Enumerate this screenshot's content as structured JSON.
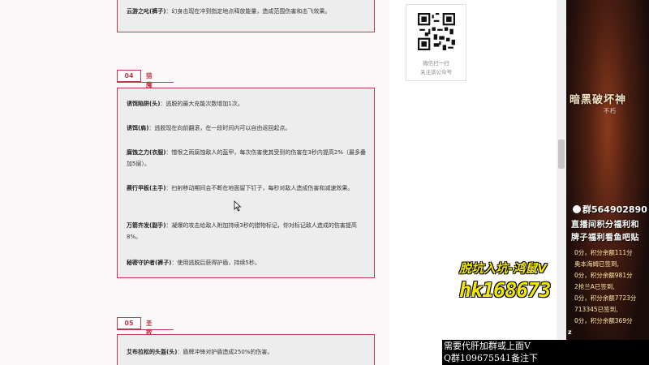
{
  "article": {
    "top_item": {
      "name": "云游之叱(裤子)",
      "text": "：幻身击现在冲到指定地点释放能量，造成范围伤害和击飞效果。"
    },
    "section04": {
      "number": "04",
      "title": "猎魔人",
      "items": [
        {
          "name": "诱饵陷阱(头)",
          "text": "：逃脱的最大充能次数增加1次。"
        },
        {
          "name": "诱饵(肩)",
          "text": "：逃脱现在向前翻滚，在一段时间内可以自由返回起点。"
        },
        {
          "name": "腐蚀之力(衣服)",
          "text": "：憎恨之雨腐蚀敌人的盔甲，每次伤害使其受到的伤害在3秒内提高2%（最多叠加5层）。"
        },
        {
          "name": "蒺行甲板(主手)",
          "text": "：扫射移动期间会不断在地面留下钉子，每秒对敌人造成伤害和减速效果。"
        },
        {
          "name": "万箭齐发(副手)",
          "text": "：凝爆的攻击给敌人附加持续3秒的猎物标记，你对标记敌人造成的伤害提高8%。"
        },
        {
          "name": "秘密守护者(裤子)",
          "text": "：使用逃脱后获得护盾，持续5秒。"
        }
      ]
    },
    "section05": {
      "number": "05",
      "title": "圣教军",
      "items": [
        {
          "name": "艾布拉松的头盔(头)",
          "text": "：盾牌冲锋对护盾造成250%的伤害。"
        }
      ]
    }
  },
  "qr_card": {
    "line1": "微信扫一扫",
    "line2": "关注该公众号"
  },
  "stream": {
    "game_title": "暗黑破坏神",
    "game_subtitle": "不朽",
    "qq_group": "群564902890",
    "promo_line1": "直播间积分福利和",
    "promo_line2": "牌子福利看鱼吧贴",
    "chat": [
      "0分，积分余额111分",
      "奥本海姆已签到,",
      "0分，积分余额981分",
      "2抢兰A已签到,",
      "0分，积分余额7723分",
      "713345已签到,",
      "0分，积分余额369分"
    ],
    "overlay_text1": "脱坑入坑-鸿鼠V",
    "overlay_text2": "hk168673",
    "ticker_line1": "需要代肝加群或上面V",
    "ticker_line2": "Q群109675541备注下",
    "z_label": "z"
  },
  "colors": {
    "accent": "#c0394b",
    "box_bg": "#ededed",
    "overlay_yellow": "#f3e600"
  },
  "icons": [
    "qr-code-icon",
    "mouse-cursor-icon",
    "qq-penguin-icon"
  ]
}
